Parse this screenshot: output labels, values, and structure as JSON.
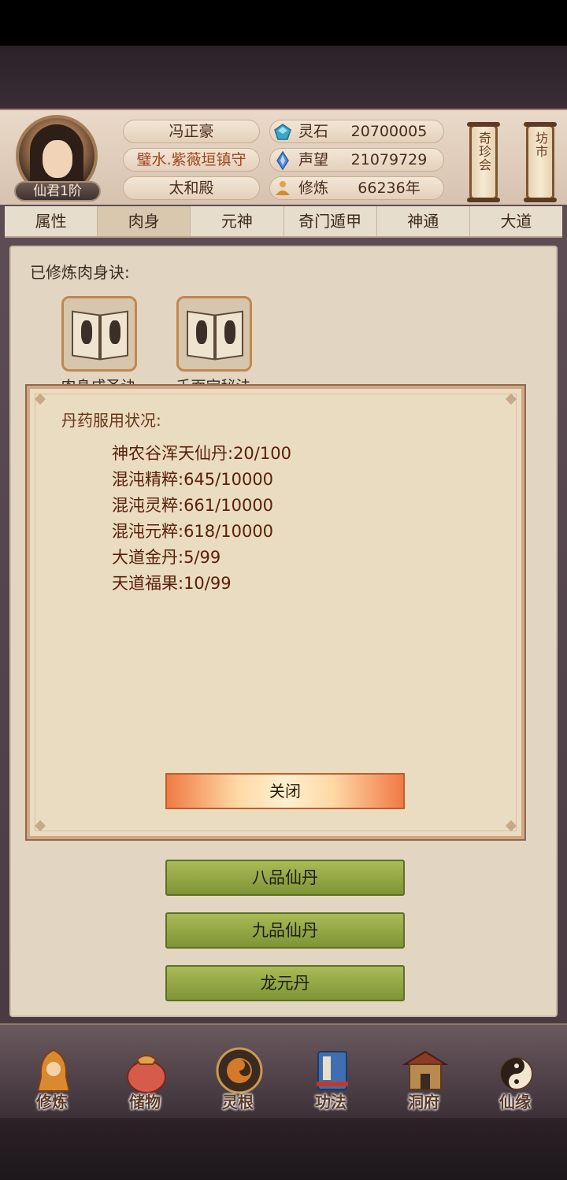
{
  "header": {
    "player_name": "冯正豪",
    "player_title": "璧水.紫薇垣镇守",
    "location": "太和殿",
    "rank": "仙君1阶",
    "stats": [
      {
        "icon": "spirit-stone-icon",
        "label": "灵石",
        "value": "20700005"
      },
      {
        "icon": "prestige-crystal-icon",
        "label": "声望",
        "value": "21079729"
      },
      {
        "icon": "meditation-icon",
        "label": "修炼",
        "value": "66236年"
      }
    ],
    "scroll_buttons": [
      "奇珍会",
      "坊市"
    ]
  },
  "tabs": [
    "属性",
    "肉身",
    "元神",
    "奇门遁甲",
    "神通",
    "大道"
  ],
  "active_tab": "肉身",
  "panel": {
    "label": "已修炼肉身诀:",
    "books": [
      "肉身成圣诀",
      "千面宝秘法"
    ],
    "pill_buttons": [
      "八品仙丹",
      "九品仙丹",
      "龙元丹"
    ]
  },
  "dialog": {
    "title": "丹药服用状况:",
    "rows": [
      "神农谷浑天仙丹:20/100",
      "混沌精粹:645/10000",
      "混沌灵粹:661/10000",
      "混沌元粹:618/10000",
      "大道金丹:5/99",
      "天道福果:10/99"
    ],
    "close_label": "关闭"
  },
  "bottom_nav": [
    {
      "icon": "cultivate-icon",
      "label": "修炼"
    },
    {
      "icon": "storage-bag-icon",
      "label": "储物"
    },
    {
      "icon": "spirit-root-icon",
      "label": "灵根"
    },
    {
      "icon": "technique-book-icon",
      "label": "功法"
    },
    {
      "icon": "cave-dwelling-icon",
      "label": "洞府"
    },
    {
      "icon": "immortal-fate-icon",
      "label": "仙缘"
    }
  ]
}
